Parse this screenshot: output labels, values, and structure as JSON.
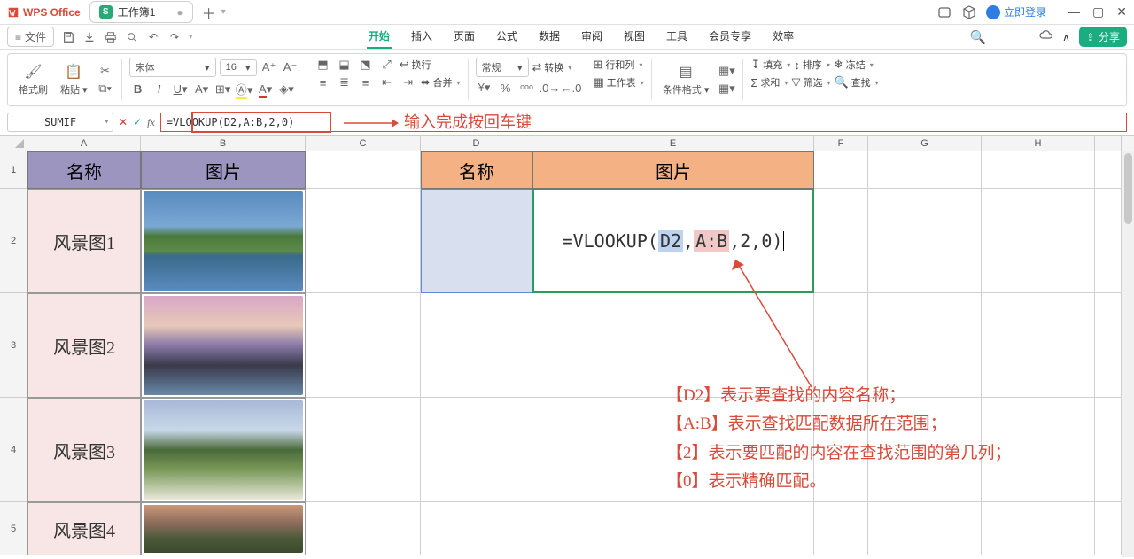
{
  "titlebar": {
    "app_name": "WPS Office",
    "doc_name": "工作簿1",
    "login": "立即登录"
  },
  "menu": {
    "file": "文件",
    "tabs": [
      "开始",
      "插入",
      "页面",
      "公式",
      "数据",
      "审阅",
      "视图",
      "工具",
      "会员专享",
      "效率"
    ],
    "active_index": 0,
    "share": "分享"
  },
  "ribbon": {
    "format_painter": "格式刷",
    "paste": "粘贴",
    "font": "宋体",
    "font_size": "16",
    "wrap": "换行",
    "merge": "合并",
    "general": "常规",
    "convert": "转换",
    "rowcol": "行和列",
    "worksheet": "工作表",
    "cond_fmt": "条件格式",
    "fill": "填充",
    "sort": "排序",
    "freeze": "冻结",
    "sum": "求和",
    "filter": "筛选",
    "find": "查找"
  },
  "formula_bar": {
    "name_box": "SUMIF",
    "formula": "=VLOOKUP(D2,A:B,2,0)"
  },
  "annotations": {
    "top": "输入完成按回车键",
    "notes": [
      "【D2】表示要查找的内容名称；",
      "【A:B】表示查找匹配数据所在范围；",
      "【2】表示要匹配的内容在查找范围的第几列；",
      "【0】表示精确匹配。"
    ]
  },
  "columns": [
    "A",
    "B",
    "C",
    "D",
    "E",
    "F",
    "G",
    "H"
  ],
  "rows": [
    "1",
    "2",
    "3",
    "4",
    "5"
  ],
  "headers": {
    "name": "名称",
    "image": "图片"
  },
  "items": [
    "风景图1",
    "风景图2",
    "风景图3",
    "风景图4"
  ],
  "e2_formula": {
    "pre": "=VLOOKUP(",
    "d2": "D2",
    "c1": ",",
    "ab": "A:B",
    "post": ",2,0)"
  }
}
